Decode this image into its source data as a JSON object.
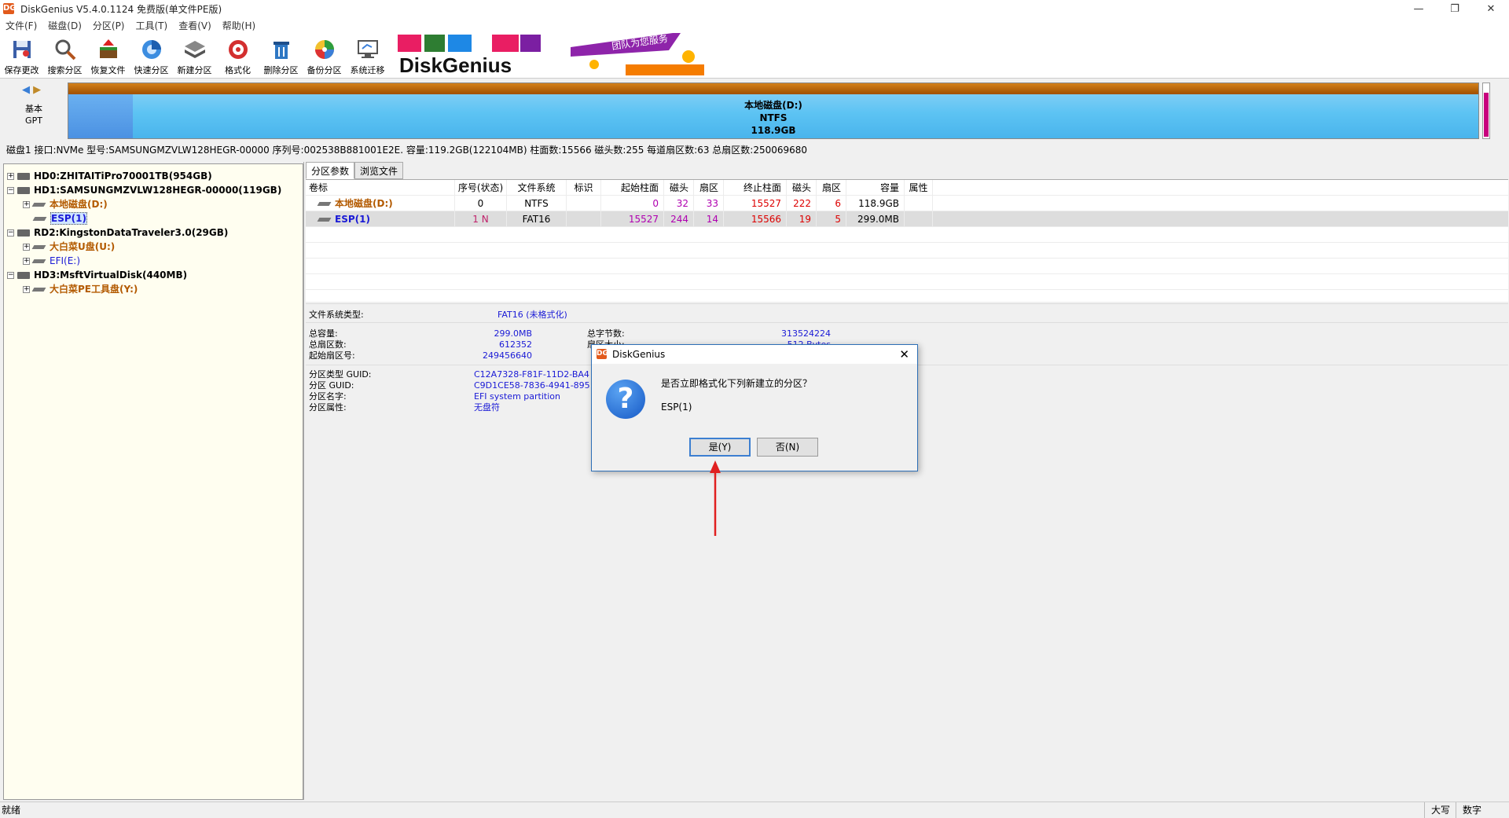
{
  "window": {
    "title": "DiskGenius V5.4.0.1124 免费版(单文件PE版)",
    "app_icon": "DG"
  },
  "menu": [
    "文件(F)",
    "磁盘(D)",
    "分区(P)",
    "工具(T)",
    "查看(V)",
    "帮助(H)"
  ],
  "toolbar": [
    {
      "label": "保存更改",
      "icon": "save-icon"
    },
    {
      "label": "搜索分区",
      "icon": "search-icon"
    },
    {
      "label": "恢复文件",
      "icon": "recover-icon"
    },
    {
      "label": "快速分区",
      "icon": "quick-partition-icon"
    },
    {
      "label": "新建分区",
      "icon": "new-partition-icon"
    },
    {
      "label": "格式化",
      "icon": "format-icon"
    },
    {
      "label": "删除分区",
      "icon": "delete-icon"
    },
    {
      "label": "备份分区",
      "icon": "backup-icon"
    },
    {
      "label": "系统迁移",
      "icon": "migrate-icon"
    }
  ],
  "banner": {
    "brand": "DiskGenius",
    "slogan": "团队为您服务"
  },
  "disk_map": {
    "type_line1": "基本",
    "type_line2": "GPT",
    "partition_name": "本地磁盘(D:)",
    "partition_fs": "NTFS",
    "partition_size": "118.9GB"
  },
  "disk_info": "磁盘1 接口:NVMe  型号:SAMSUNGMZVLW128HEGR-00000  序列号:002538B881001E2E.  容量:119.2GB(122104MB)  柱面数:15566  磁头数:255  每道扇区数:63  总扇区数:250069680",
  "tree": [
    {
      "label": "HD0:ZHITAITiPro70001TB(954GB)",
      "kind": "disk"
    },
    {
      "label": "HD1:SAMSUNGMZVLW128HEGR-00000(119GB)",
      "kind": "disk"
    },
    {
      "label": "本地磁盘(D:)",
      "kind": "part-orange"
    },
    {
      "label": "ESP(1)",
      "kind": "part-selected"
    },
    {
      "label": "RD2:KingstonDataTraveler3.0(29GB)",
      "kind": "disk"
    },
    {
      "label": "大白菜U盘(U:)",
      "kind": "part-orange"
    },
    {
      "label": "EFI(E:)",
      "kind": "part-blue"
    },
    {
      "label": "HD3:MsftVirtualDisk(440MB)",
      "kind": "disk"
    },
    {
      "label": "大白菜PE工具盘(Y:)",
      "kind": "part-orange"
    }
  ],
  "tabs": [
    "分区参数",
    "浏览文件"
  ],
  "table": {
    "headers": [
      "卷标",
      "序号(状态)",
      "文件系统",
      "标识",
      "起始柱面",
      "磁头",
      "扇区",
      "终止柱面",
      "磁头",
      "扇区",
      "容量",
      "属性"
    ],
    "rows": [
      [
        "本地磁盘(D:)",
        "0",
        "NTFS",
        "",
        "0",
        "32",
        "33",
        "15527",
        "222",
        "6",
        "118.9GB",
        ""
      ],
      [
        "ESP(1)",
        "1 N",
        "FAT16",
        "",
        "15527",
        "244",
        "14",
        "15566",
        "19",
        "5",
        "299.0MB",
        ""
      ]
    ]
  },
  "props": {
    "fs_type_label": "文件系统类型:",
    "fs_type_value": "FAT16 (未格式化)",
    "total_cap_label": "总容量:",
    "total_cap_value": "299.0MB",
    "total_bytes_label": "总字节数:",
    "total_bytes_value": "313524224",
    "total_sectors_label": "总扇区数:",
    "total_sectors_value": "612352",
    "sector_size_label": "扇区大小:",
    "sector_size_value": "512 Bytes",
    "start_sector_label": "起始扇区号:",
    "start_sector_value": "249456640",
    "type_guid_label": "分区类型 GUID:",
    "type_guid_value": "C12A7328-F81F-11D2-BA4",
    "part_guid_label": "分区 GUID:",
    "part_guid_value": "C9D1CE58-7836-4941-895",
    "part_name_label": "分区名字:",
    "part_name_value": "EFI system partition",
    "part_attr_label": "分区属性:",
    "part_attr_value": "无盘符"
  },
  "dialog": {
    "title": "DiskGenius",
    "message": "是否立即格式化下列新建立的分区？",
    "partition": "ESP(1)",
    "yes": "是(Y)",
    "no": "否(N)"
  },
  "status": {
    "ready": "就绪",
    "caps": "大写",
    "num": "数字"
  },
  "colors": {
    "accent": "#3c7fd1",
    "annotation_arrow": "#e02020",
    "partition_ntfs": "#5cc3f3",
    "partition_header": "#a05000"
  }
}
